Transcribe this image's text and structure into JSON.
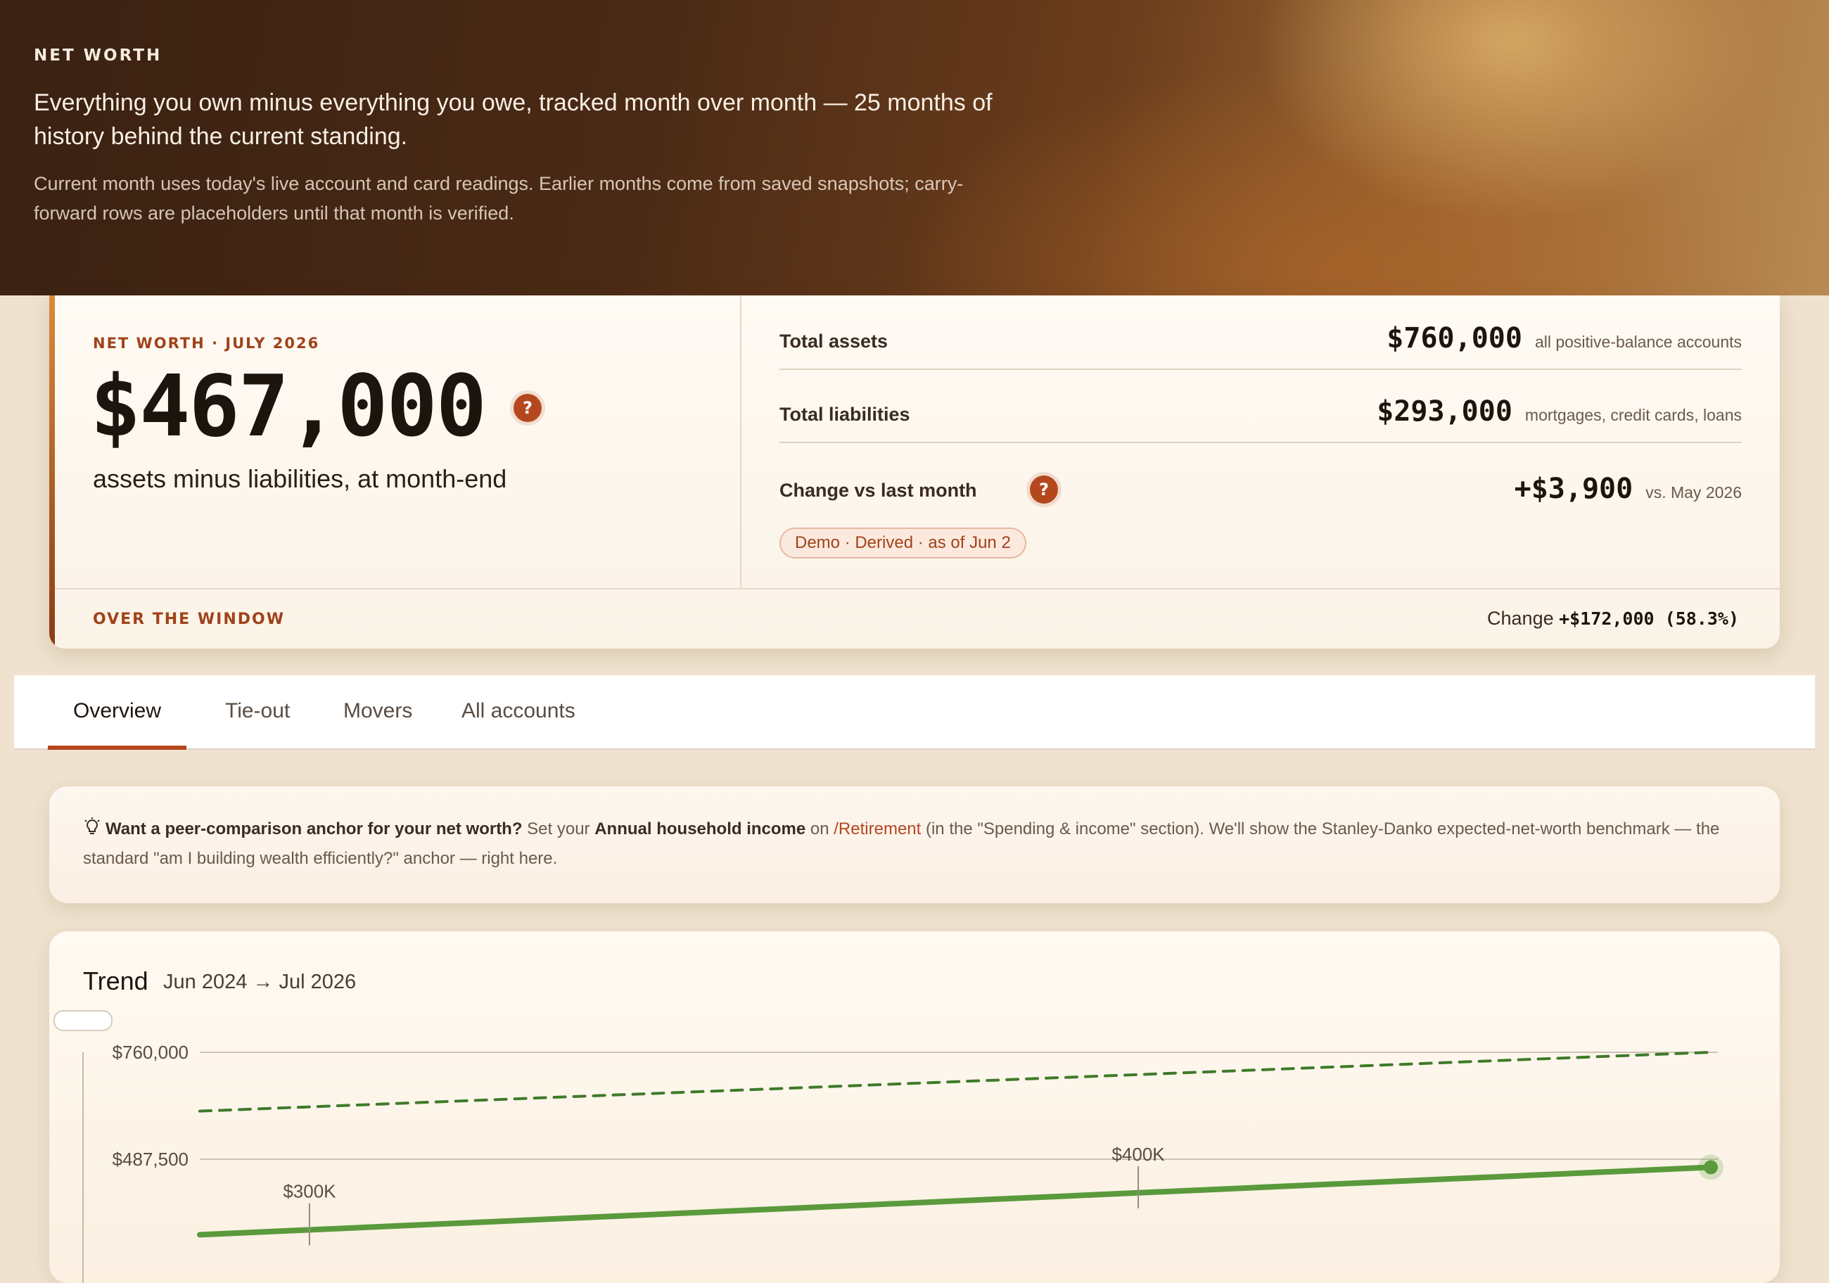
{
  "hero": {
    "eyebrow": "NET WORTH",
    "title": "Everything you own minus everything you owe, tracked month over month — 25 months of history behind the current standing.",
    "subtitle": "Current month uses today's live account and card readings. Earlier months come from saved snapshots; carry-forward rows are placeholders until that month is verified."
  },
  "summary": {
    "eyebrow": "NET WORTH · JULY 2026",
    "value": "$467,000",
    "help": "?",
    "caption": "assets minus liabilities, at month-end",
    "assets": {
      "label": "Total assets",
      "value": "$760,000",
      "note": "all positive-balance accounts"
    },
    "liabilities": {
      "label": "Total liabilities",
      "value": "$293,000",
      "note": "mortgages, credit cards, loans"
    },
    "change": {
      "label": "Change vs last month",
      "value": "+$3,900",
      "note": "vs. May 2026",
      "help": "?"
    },
    "pill": "Demo · Derived · as of Jun 2",
    "window_label": "OVER THE WINDOW",
    "window_change_label": "Change",
    "window_change_value": "+$172,000 (58.3%)"
  },
  "tabs": [
    {
      "label": "Overview",
      "active": true
    },
    {
      "label": "Tie-out",
      "active": false
    },
    {
      "label": "Movers",
      "active": false
    },
    {
      "label": "All accounts",
      "active": false
    }
  ],
  "tip": {
    "icon": "lightbulb-icon",
    "lead": "Want a peer-comparison anchor for your net worth?",
    "t1": " Set your ",
    "field": "Annual household income",
    "t2": " on ",
    "link": "/Retirement",
    "t3": " (in the \"Spending & income\" section). We'll show the Stanley-Danko expected-net-worth benchmark — the standard \"am I building wealth efficiently?\" anchor — right here."
  },
  "trend": {
    "title": "Trend",
    "range": "Jun 2024 → Jul 2026"
  },
  "chart_data": {
    "type": "line",
    "x_range": [
      "Jun 2024",
      "Jul 2026"
    ],
    "y_ticks": [
      {
        "value": 760000,
        "label": "$760,000"
      },
      {
        "value": 487500,
        "label": "$487,500"
      }
    ],
    "series": [
      {
        "style": "dashed",
        "color": "#3f7a2a",
        "start": 610000,
        "end": 760000
      },
      {
        "style": "solid",
        "color": "#5a9a3c",
        "start": 295000,
        "end": 467000
      }
    ],
    "annotations": [
      {
        "label": "$300K",
        "at": 0.07
      },
      {
        "label": "$400K",
        "at": 0.62
      }
    ],
    "colors": {
      "accent": "#b5471f",
      "line": "#5a9a3c",
      "dash": "#3f7a2a"
    }
  }
}
